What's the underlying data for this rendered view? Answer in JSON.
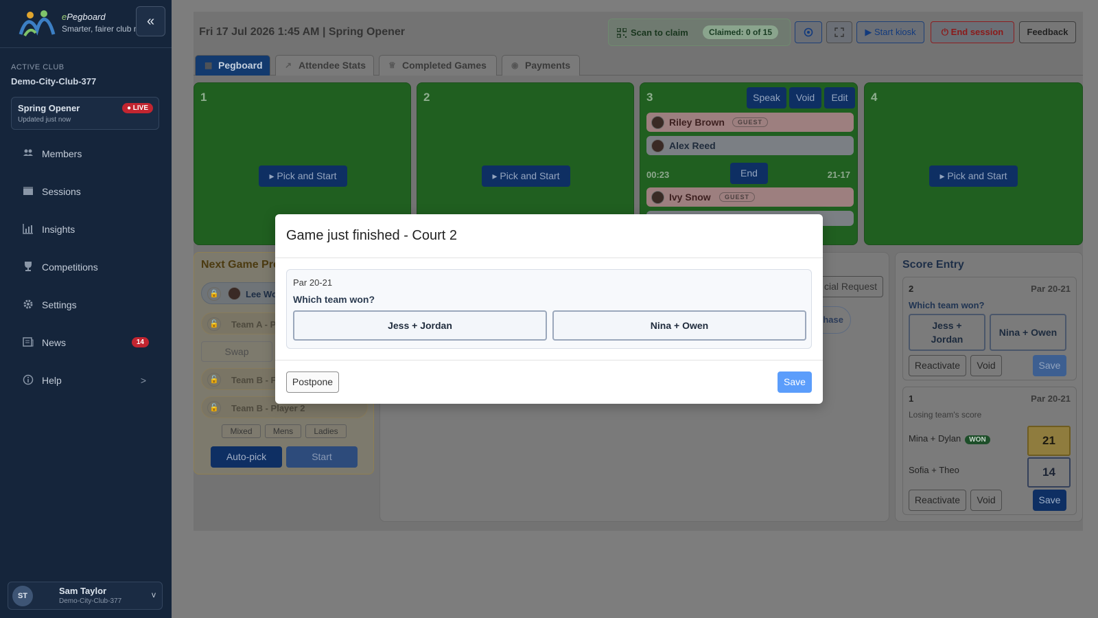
{
  "sidebar": {
    "brand_prefix": "e",
    "brand_name": "Pegboard",
    "brand_tagline": "Smarter, fairer club nights",
    "collapse_label": "«",
    "active_club_label": "ACTIVE CLUB",
    "club_name": "Demo-City-Club-377",
    "session": {
      "title": "Spring Opener",
      "updated": "Updated just now",
      "live_label": "LIVE"
    },
    "items": [
      {
        "label": "Members",
        "icon": "members-icon"
      },
      {
        "label": "Sessions",
        "icon": "sessions-icon"
      },
      {
        "label": "Insights",
        "icon": "insights-icon"
      },
      {
        "label": "Competitions",
        "icon": "trophy-icon"
      },
      {
        "label": "Settings",
        "icon": "gear-icon"
      },
      {
        "label": "News",
        "icon": "news-icon",
        "badge": "14"
      },
      {
        "label": "Help",
        "icon": "help-icon",
        "chevron": ">"
      }
    ],
    "user": {
      "initials": "ST",
      "name": "Sam Taylor",
      "club": "Demo-City-Club-377",
      "chevron": "v"
    }
  },
  "topbar": {
    "datetime": "Fri 17 Jul 2026 1:45 AM | Spring Opener",
    "scan_label": "Scan to claim",
    "claimed": "Claimed: 0 of 15",
    "start_kiosk": "Start kiosk",
    "end_session": "End session",
    "feedback": "Feedback"
  },
  "tabs": [
    {
      "label": "Pegboard",
      "active": true
    },
    {
      "label": "Attendee Stats"
    },
    {
      "label": "Completed Games"
    },
    {
      "label": "Payments"
    }
  ],
  "courts": [
    {
      "number": "1",
      "pick_label": "Pick and Start"
    },
    {
      "number": "2",
      "pick_label": "Pick and Start"
    },
    {
      "number": "3",
      "actions": [
        "Speak",
        "Void",
        "Edit"
      ],
      "players_top": [
        {
          "name": "Riley Brown",
          "tag": "GUEST"
        },
        {
          "name": "Alex Reed"
        }
      ],
      "timer": "00:23",
      "end_label": "End",
      "score": "21-17",
      "players_bottom": [
        {
          "name": "Ivy Snow",
          "tag": "GUEST"
        }
      ]
    },
    {
      "number": "4",
      "pick_label": "Pick and Start"
    }
  ],
  "next_game": {
    "title": "Next Game Pre",
    "slots": [
      "Lee Wo",
      "Team A - P",
      "Team B - F",
      "Team B - Player 2"
    ],
    "swap_label": "Swap",
    "filters": [
      "Mixed",
      "Mens",
      "Ladies"
    ],
    "autopick_label": "Auto-pick",
    "start_label": "Start"
  },
  "middle": {
    "special_request": "cial Request",
    "phase": "hase"
  },
  "score_entry": {
    "title": "Score Entry",
    "cards": [
      {
        "court": "2",
        "par": "Par 20-21",
        "question": "Which team won?",
        "teams": [
          "Jess + Jordan",
          "Nina + Owen"
        ],
        "reactivate": "Reactivate",
        "void": "Void",
        "save": "Save"
      },
      {
        "court": "1",
        "par": "Par 20-21",
        "sublabel": "Losing team's score",
        "rows": [
          {
            "team": "Mina + Dylan",
            "won_label": "WON",
            "score": "21"
          },
          {
            "team": "Sofia + Theo",
            "score": "14"
          }
        ],
        "reactivate": "Reactivate",
        "void": "Void",
        "save": "Save"
      }
    ]
  },
  "modal": {
    "title": "Game just finished - Court 2",
    "par": "Par 20-21",
    "question": "Which team won?",
    "team_a": "Jess + Jordan",
    "team_b": "Nina + Owen",
    "postpone": "Postpone",
    "save": "Save"
  },
  "colors": {
    "sidebar_bg": "#15253b",
    "court_green": "#205f20",
    "primary_blue": "#0e2f63",
    "live_red": "#c22530",
    "modal_save_blue": "#5b9dfb"
  }
}
